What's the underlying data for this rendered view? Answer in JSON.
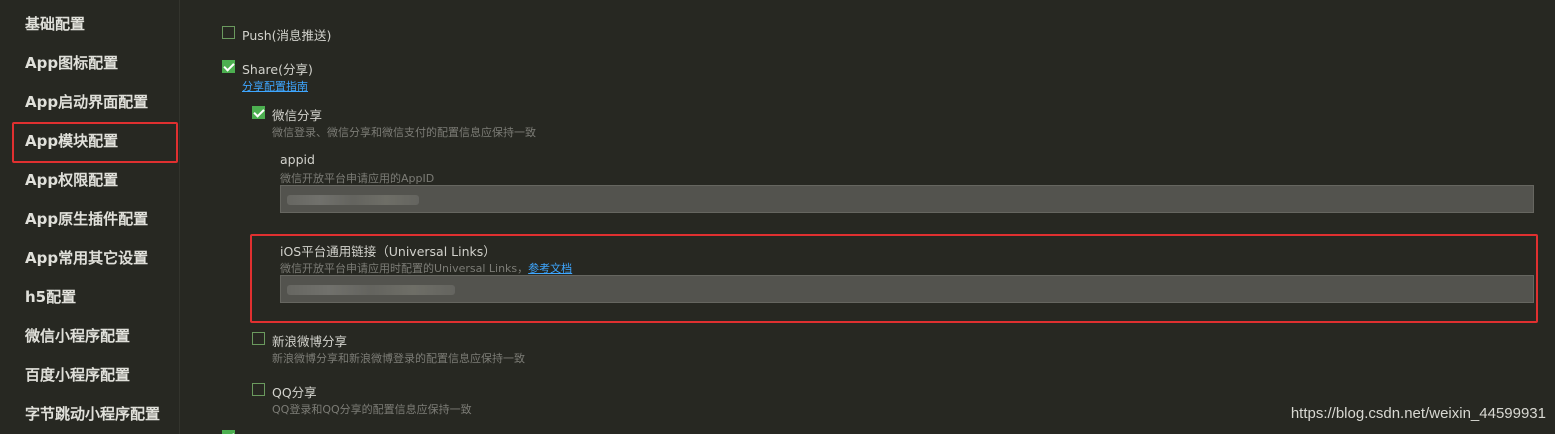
{
  "sidebar": {
    "items": [
      {
        "label": "基础配置"
      },
      {
        "label": "App图标配置"
      },
      {
        "label": "App启动界面配置"
      },
      {
        "label": "App模块配置"
      },
      {
        "label": "App权限配置"
      },
      {
        "label": "App原生插件配置"
      },
      {
        "label": "App常用其它设置"
      },
      {
        "label": "h5配置"
      },
      {
        "label": "微信小程序配置"
      },
      {
        "label": "百度小程序配置"
      },
      {
        "label": "字节跳动小程序配置"
      }
    ],
    "active_index": 3
  },
  "modules": {
    "push": {
      "label": "Push(消息推送)",
      "checked": false
    },
    "share": {
      "label": "Share(分享)",
      "checked": true,
      "guide_link": "分享配置指南",
      "weixin": {
        "label": "微信分享",
        "checked": true,
        "description": "微信登录、微信分享和微信支付的配置信息应保持一致",
        "appid": {
          "label": "appid",
          "description": "微信开放平台申请应用的AppID"
        },
        "universal_links": {
          "label": "iOS平台通用链接（Universal Links）",
          "description": "微信开放平台申请应用时配置的Universal Links，",
          "doc_link": "参考文档"
        }
      },
      "sina": {
        "label": "新浪微博分享",
        "checked": false,
        "description": "新浪微博分享和新浪微博登录的配置信息应保持一致"
      },
      "qq": {
        "label": "QQ分享",
        "checked": false,
        "description": "QQ登录和QQ分享的配置信息应保持一致"
      }
    }
  },
  "watermark": "https://blog.csdn.net/weixin_44599931",
  "colors": {
    "background": "#272822",
    "highlight": "#e03030",
    "checkbox_checked": "#4caf50",
    "link": "#3ea6ff"
  }
}
